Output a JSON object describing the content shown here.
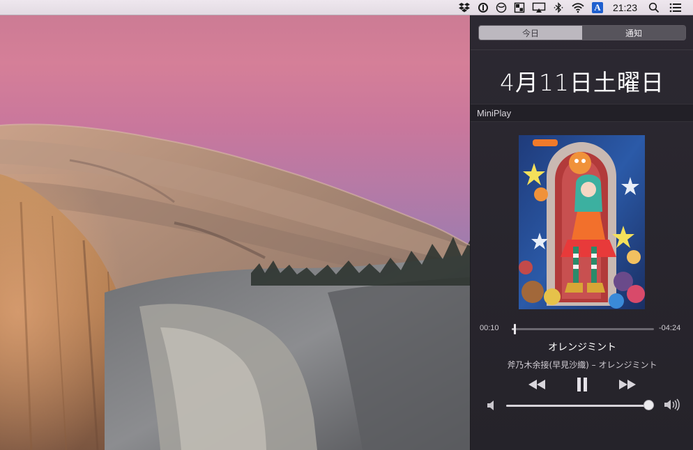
{
  "menubar": {
    "icons": [
      "dropbox-icon",
      "1password-icon",
      "do-not-disturb-icon",
      "window-manager-icon",
      "airplay-icon",
      "bluetooth-icon",
      "wifi-icon",
      "input-source-icon",
      "spotlight-icon",
      "notification-center-icon"
    ],
    "input_source_label": "A",
    "clock": "21:23"
  },
  "notification_center": {
    "tabs": [
      {
        "label": "今日",
        "selected": true
      },
      {
        "label": "通知",
        "selected": false
      }
    ],
    "date": "4月11日土曜日",
    "widget": {
      "name": "MiniPlay",
      "player": {
        "elapsed": "00:10",
        "remaining": "-04:24",
        "progress_fraction": 0.02,
        "track_title": "オレンジミント",
        "track_subtitle": "斧乃木余接(早見沙織) – オレンジミント",
        "controls": [
          "rewind-icon",
          "pause-icon",
          "fast-forward-icon"
        ],
        "volume_fraction": 0.99
      }
    }
  },
  "colors": {
    "panel_bg": "#29262e",
    "selected_tab_bg": "#bcb8bf",
    "unselected_tab_bg": "#57545c",
    "input_source_bg": "#1f5fcf"
  }
}
